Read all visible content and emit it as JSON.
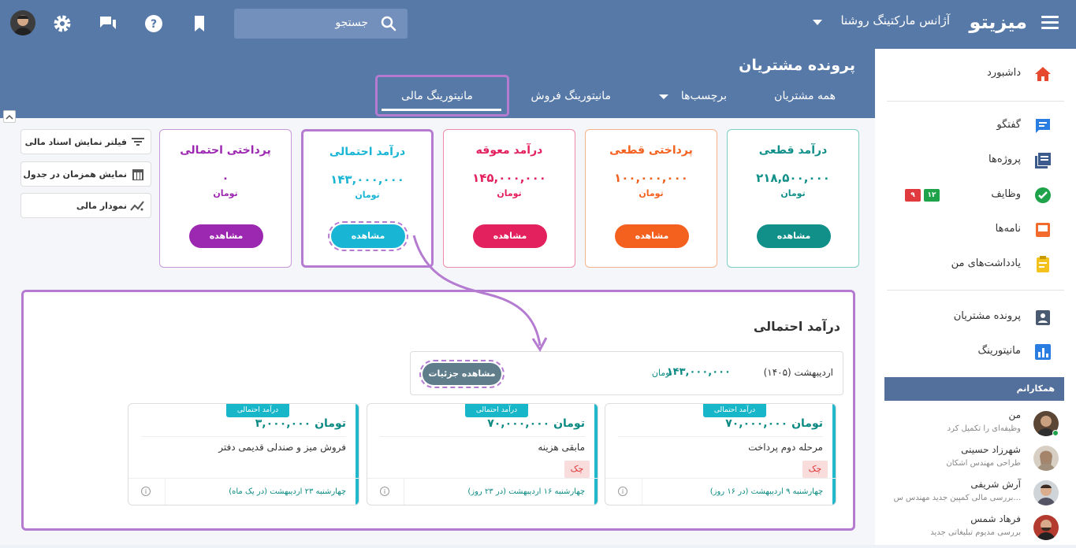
{
  "topbar": {
    "brand": "میزیتو",
    "agency": "آژانس مارکتینگ روشنا",
    "search_placeholder": "جستجو",
    "colors": {
      "bar": "#5779a8",
      "accent": "#b57bd1"
    }
  },
  "header": {
    "title": "پرونده مشتریان",
    "tabs": [
      {
        "label": "همه مشتریان"
      },
      {
        "label": "برچسب‌ها"
      },
      {
        "label": "مانیتورینگ فروش"
      },
      {
        "label": "مانیتورینگ مالی",
        "selected": true
      }
    ]
  },
  "cards": [
    {
      "title": "درآمد قطعی",
      "value": "۲۱۸,۵۰۰,۰۰۰",
      "unit": "تومان",
      "button": "مشاهده",
      "color": "#11908a"
    },
    {
      "title": "پرداختی قطعی",
      "value": "۱۰۰,۰۰۰,۰۰۰",
      "unit": "تومان",
      "button": "مشاهده",
      "color": "#f4611f"
    },
    {
      "title": "درآمد معوقه",
      "value": "۱۴۵,۰۰۰,۰۰۰",
      "unit": "تومان",
      "button": "مشاهده",
      "color": "#e4215f"
    },
    {
      "title": "درآمد احتمالی",
      "value": "۱۴۳,۰۰۰,۰۰۰",
      "unit": "تومان",
      "button": "مشاهده",
      "color": "#19b5d4"
    },
    {
      "title": "پرداختی احتمالی",
      "value": "۰",
      "unit": "تومان",
      "button": "مشاهده",
      "color": "#9c27b0"
    }
  ],
  "filters": {
    "filter_label": "فیلتر نمایش اسناد مالی",
    "table_label": "نمایش همزمان در جدول",
    "chart_label": "نمودار مالی"
  },
  "panel": {
    "title": "درآمد احتمالی",
    "summary": {
      "period": "اردیبهشت (۱۴۰۵)",
      "amount": "۱۴۳,۰۰۰,۰۰۰",
      "currency": "تومان",
      "details_button": "مشاهده جزئیات"
    },
    "items": [
      {
        "tag": "درآمد احتمالی",
        "amount": "۷۰,۰۰۰,۰۰۰ تومان",
        "desc": "مرحله دوم پرداخت",
        "check": "چک",
        "date": "چهارشنبه ۹ اردیبهشت (در ۱۶ روز)"
      },
      {
        "tag": "درآمد احتمالی",
        "amount": "۷۰,۰۰۰,۰۰۰ تومان",
        "desc": "مابقی هزینه",
        "check": "چک",
        "date": "چهارشنبه ۱۶ اردیبهشت (در ۲۳ روز)"
      },
      {
        "tag": "درآمد احتمالی",
        "amount": "۳,۰۰۰,۰۰۰ تومان",
        "desc": "فروش میز و صندلی قدیمی دفتر",
        "check": "",
        "date": "چهارشنبه ۲۳ اردیبهشت (در یک ماه)"
      }
    ]
  },
  "sidebar": {
    "items": [
      {
        "label": "داشبورد",
        "icon": "home-icon",
        "color": "#e64a2e"
      },
      {
        "label": "گفتگو",
        "icon": "chat-icon",
        "color": "#2a7de1"
      },
      {
        "label": "پروژه‌ها",
        "icon": "projects-icon",
        "color": "#3b5b8c"
      },
      {
        "label": "وظایف",
        "icon": "tasks-icon",
        "color": "#1ea34a"
      },
      {
        "label": "نامه‌ها",
        "icon": "mail-icon",
        "color": "#f26b2c"
      },
      {
        "label": "یادداشت‌های من",
        "icon": "notes-icon",
        "color": "#f3c21c"
      },
      {
        "label": "پرونده مشتریان",
        "icon": "customer-file-icon",
        "color": "#4a5a70"
      },
      {
        "label": "مانیتورینگ",
        "icon": "monitoring-icon",
        "color": "#2a7de1"
      }
    ],
    "task_badges": {
      "green": "۱۲",
      "red": "۹"
    },
    "colleagues_title": "همکارانم",
    "people": [
      {
        "name": "من",
        "desc": "وظیفه‌ای را تکمیل کرد"
      },
      {
        "name": "شهرزاد حسینی",
        "desc": "طراحی مهندس اشکان"
      },
      {
        "name": "آرش شریفی",
        "desc": "بررسی مالی کمپین جدید مهندس س..."
      },
      {
        "name": "فرهاد شمس",
        "desc": "بررسی مدیوم تبلیغاتی جدید"
      }
    ]
  }
}
